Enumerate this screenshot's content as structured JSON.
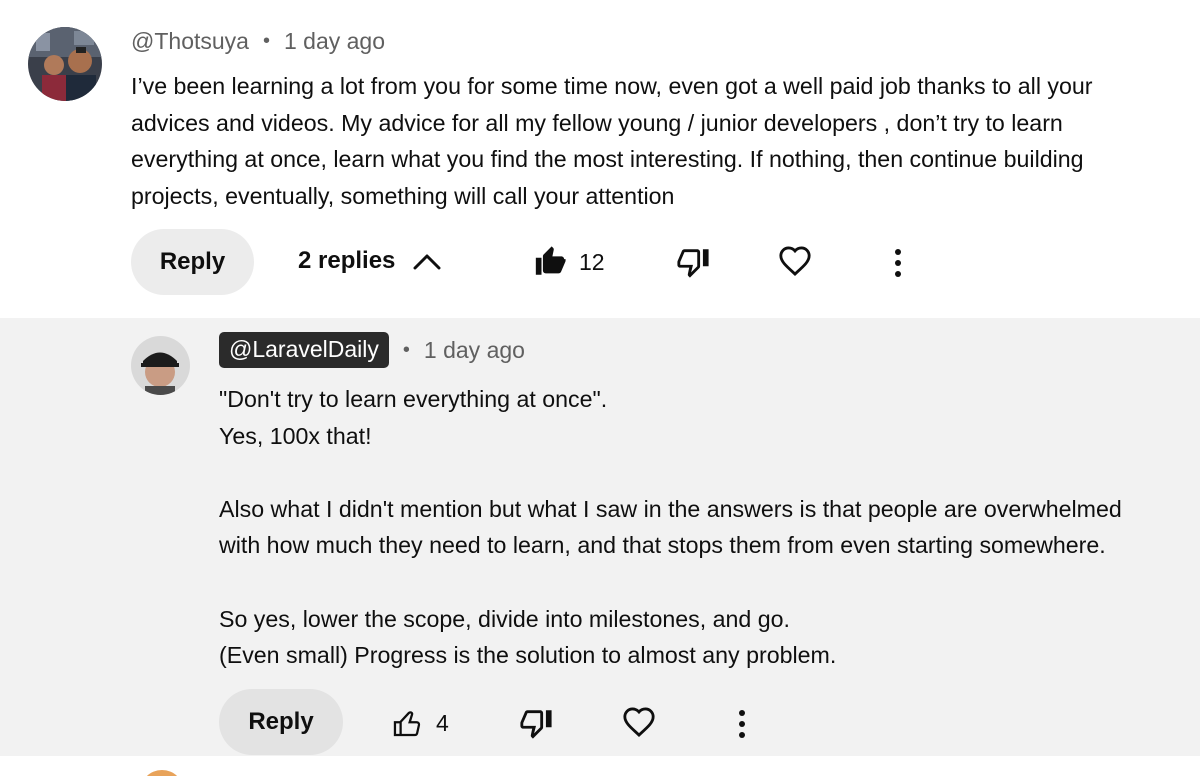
{
  "comment": {
    "author": "@Thotsuya",
    "separator": "•",
    "time": "1 day ago",
    "lines": [
      "I’ve been learning a lot from you for some time now, even got a well paid job thanks to all your",
      "advices and videos. My advice for all my fellow young / junior developers , don’t try to learn",
      "everything at once, learn what you find the most interesting. If nothing, then continue building",
      "projects, eventually, something will call your attention"
    ],
    "reply_label": "Reply",
    "replies_label": "2 replies",
    "like_count": "12",
    "liked": true
  },
  "reply": {
    "author": "@LaravelDaily",
    "separator": "•",
    "time": "1 day ago",
    "paragraphs": [
      [
        "\"Don't try to learn everything at once\".",
        "Yes, 100x that!"
      ],
      [
        "Also what I didn't mention but what I saw in the answers is that people are overwhelmed",
        "with how much they need to learn, and that stops them from even starting somewhere."
      ],
      [
        "So yes, lower the scope, divide into milestones, and go.",
        "(Even small) Progress is the solution to almost any problem."
      ]
    ],
    "reply_label": "Reply",
    "like_count": "4",
    "liked": false
  },
  "icons": {
    "comment_avatar": "avatar-photo-two-men",
    "reply_avatar": "avatar-photo-man-cap",
    "like": "thumbs-up-icon",
    "dislike": "thumbs-down-icon",
    "heart": "heart-icon",
    "more": "more-vertical-icon",
    "collapse": "chevron-up-icon"
  },
  "colors": {
    "reply_background": "#f2f2f2",
    "badge_background": "#2b2b2b",
    "meta_text": "#606060"
  }
}
